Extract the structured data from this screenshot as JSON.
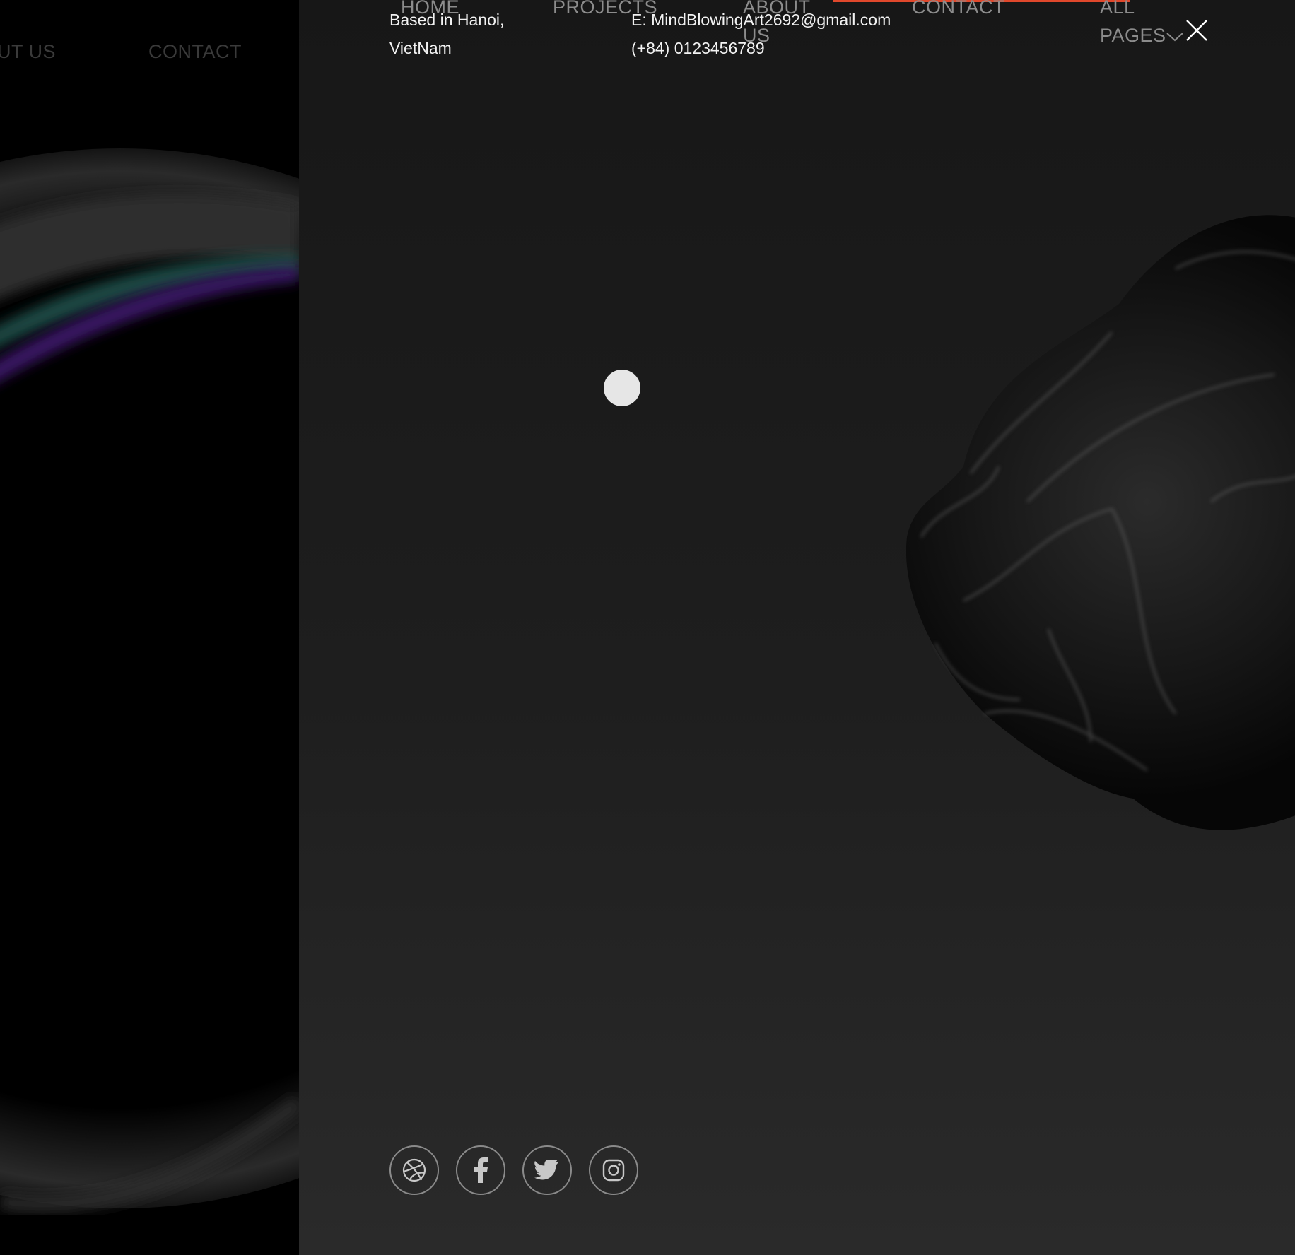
{
  "background_page": {
    "nav": [
      {
        "label": "UT US"
      },
      {
        "label": "CONTACT"
      }
    ]
  },
  "menu": {
    "nav": [
      {
        "label": "HOME"
      },
      {
        "label": "PROJECTS"
      },
      {
        "label": "ABOUT"
      },
      {
        "label": "US"
      },
      {
        "label": "CONTACT"
      },
      {
        "label": "ALL"
      },
      {
        "label": "PAGES"
      }
    ],
    "location_line1": "Based in Hanoi,",
    "location_line2": "VietNam",
    "email": "E: MindBlowingArt2692@gmail.com",
    "phone": "(+84) 0123456789",
    "accent_color": "#e0482c",
    "socials": [
      {
        "icon": "dribbble-icon"
      },
      {
        "icon": "facebook-icon"
      },
      {
        "icon": "twitter-icon"
      },
      {
        "icon": "instagram-icon"
      }
    ]
  }
}
